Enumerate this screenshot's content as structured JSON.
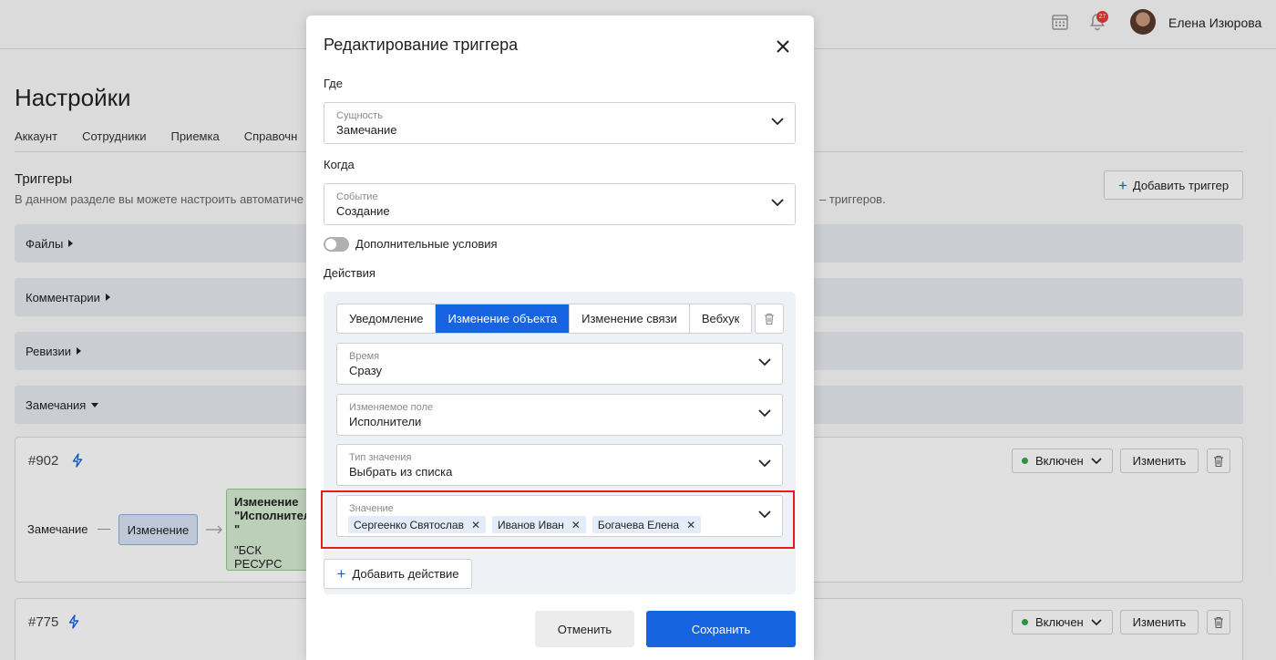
{
  "header": {
    "user_name": "Елена Изюрова",
    "notification_count": "27"
  },
  "page": {
    "title": "Настройки",
    "tabs": [
      "Аккаунт",
      "Сотрудники",
      "Приемка",
      "Справочн"
    ],
    "section_title": "Триггеры",
    "section_desc": "В данном разделе вы можете настроить автоматиче",
    "section_desc_tail": "– триггеров.",
    "add_trigger_label": "Добавить триггер",
    "groups": [
      "Файлы",
      "Комментарии",
      "Ревизии",
      "Замечания"
    ]
  },
  "cards": [
    {
      "id": "#902",
      "state": "Включен",
      "edit_label": "Изменить",
      "flow_entity": "Замечание",
      "flow_event": "Изменение",
      "flow_action_line1": "Изменение",
      "flow_action_line2": "\"Исполнител",
      "flow_action_line3": "\"",
      "flow_action_line4": "\"БСК РЕСУРС"
    },
    {
      "id": "#775",
      "state": "Включен",
      "edit_label": "Изменить"
    }
  ],
  "modal": {
    "title": "Редактирование триггера",
    "where_label": "Где",
    "entity_caption": "Сущность",
    "entity_value": "Замечание",
    "when_label": "Когда",
    "event_caption": "Событие",
    "event_value": "Создание",
    "extra_conditions_label": "Дополнительные условия",
    "actions_label": "Действия",
    "action_tabs": [
      "Уведомление",
      "Изменение объекта",
      "Изменение связи",
      "Вебхук"
    ],
    "active_tab": "Изменение объекта",
    "time_caption": "Время",
    "time_value": "Сразу",
    "field_caption": "Изменяемое поле",
    "field_value": "Исполнители",
    "value_type_caption": "Тип значения",
    "value_type_value": "Выбрать из списка",
    "value_caption": "Значение",
    "value_tags": [
      "Сергеенко Святослав",
      "Иванов Иван",
      "Богачева Елена"
    ],
    "add_action_label": "Добавить действие",
    "cancel_label": "Отменить",
    "save_label": "Сохранить"
  },
  "colors": {
    "accent": "#1664e0",
    "highlight": "#e02020",
    "status_on": "#2ea84a"
  }
}
